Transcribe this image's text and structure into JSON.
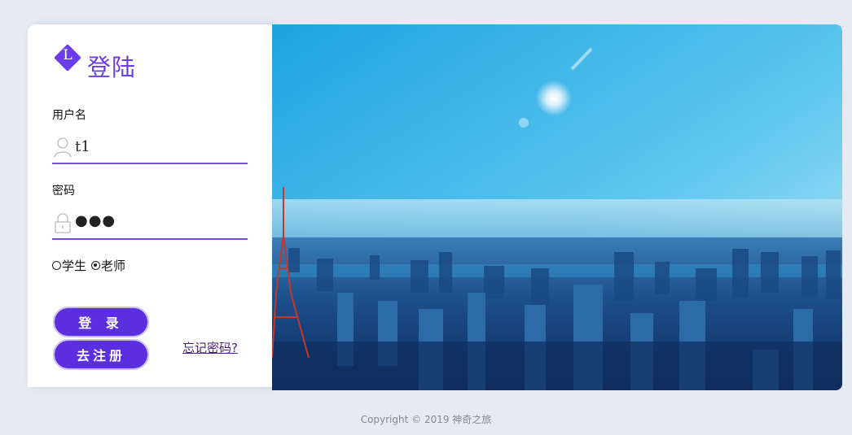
{
  "brand": {
    "logo_letter": "L",
    "title": "登陆"
  },
  "form": {
    "username_label": "用户名",
    "username_value": "t1",
    "password_label": "密码",
    "password_value": "●●●",
    "roles": [
      {
        "label": "学生",
        "selected": false
      },
      {
        "label": "老师",
        "selected": true
      }
    ],
    "login_label": "登 录",
    "register_label": "去注册",
    "forgot_label": "忘记密码?"
  },
  "footer": {
    "copyright": "Copyright © 2019 神奇之旅"
  },
  "colors": {
    "accent": "#6a3de8",
    "button": "#5b2ee0",
    "background": "#e5ebf5"
  }
}
